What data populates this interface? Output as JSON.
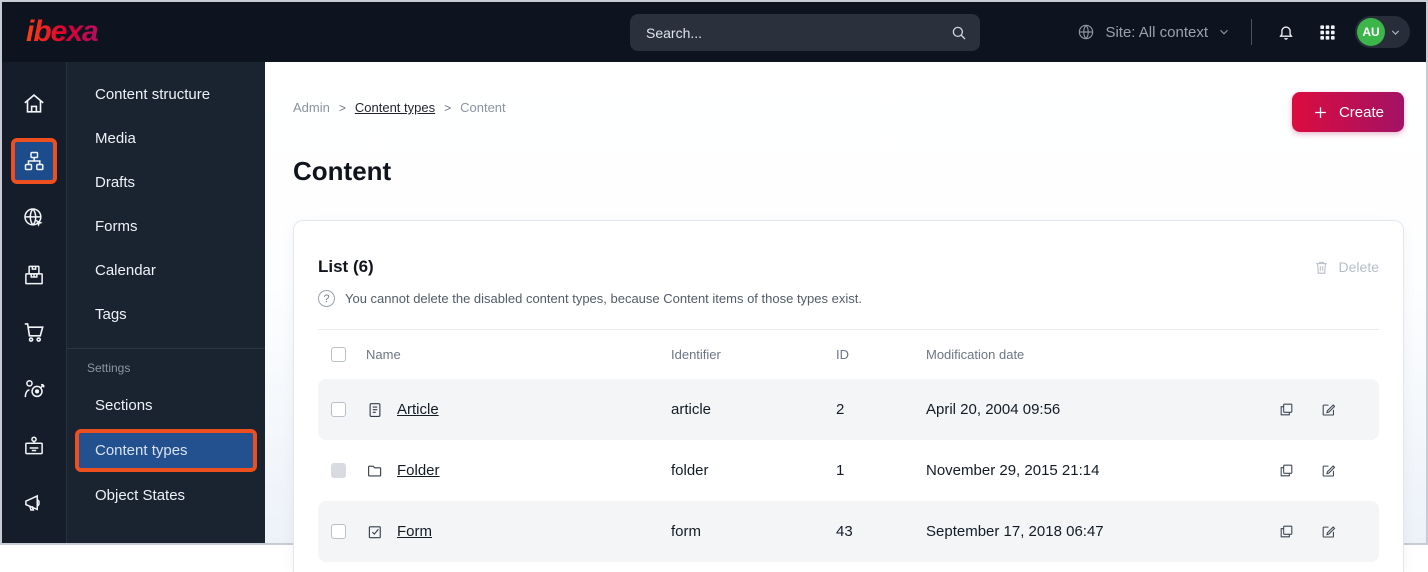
{
  "topbar": {
    "logo": "ibexa",
    "search": {
      "placeholder": "Search..."
    },
    "site_context": {
      "label": "Site: All context"
    },
    "icons": [
      "globe-icon",
      "bell-icon",
      "app-grid-icon"
    ],
    "avatar": {
      "initials": "AU"
    }
  },
  "sidebar": {
    "rail_icons": [
      "home",
      "content-structure",
      "site",
      "product-catalog",
      "commerce",
      "personalization",
      "admin",
      "campaign"
    ],
    "rail_active": "content-structure",
    "menu": [
      "Content structure",
      "Media",
      "Drafts",
      "Forms",
      "Calendar",
      "Tags"
    ],
    "settings_label": "Settings",
    "settings_menu": [
      "Sections",
      "Content types",
      "Object States"
    ],
    "active_item": "Content types"
  },
  "breadcrumb": {
    "items": [
      "Admin",
      "Content types",
      "Content"
    ]
  },
  "page": {
    "title": "Content",
    "create_button": "Create"
  },
  "list": {
    "title": "List (6)",
    "info": "You cannot delete the disabled content types, because Content items of those types exist.",
    "delete_button": "Delete",
    "columns": {
      "name": "Name",
      "identifier": "Identifier",
      "id": "ID",
      "modified": "Modification date"
    },
    "rows": [
      {
        "icon": "article-icon",
        "name": "Article",
        "identifier": "article",
        "id": "2",
        "modified": "April 20, 2004 09:56",
        "checkbox_disabled": false
      },
      {
        "icon": "folder-icon",
        "name": "Folder",
        "identifier": "folder",
        "id": "1",
        "modified": "November 29, 2015 21:14",
        "checkbox_disabled": true
      },
      {
        "icon": "form-icon",
        "name": "Form",
        "identifier": "form",
        "id": "43",
        "modified": "September 17, 2018 06:47",
        "checkbox_disabled": false
      }
    ]
  },
  "colors": {
    "annotation_orange": "#ee4f1e",
    "selected_blue": "#23508f",
    "brand_gradient_start": "#db0c3f",
    "brand_gradient_end": "#a31264",
    "avatar_green": "#3cb54a",
    "topbar_bg": "#0d1420",
    "sidebar_bg": "#1a2431"
  }
}
